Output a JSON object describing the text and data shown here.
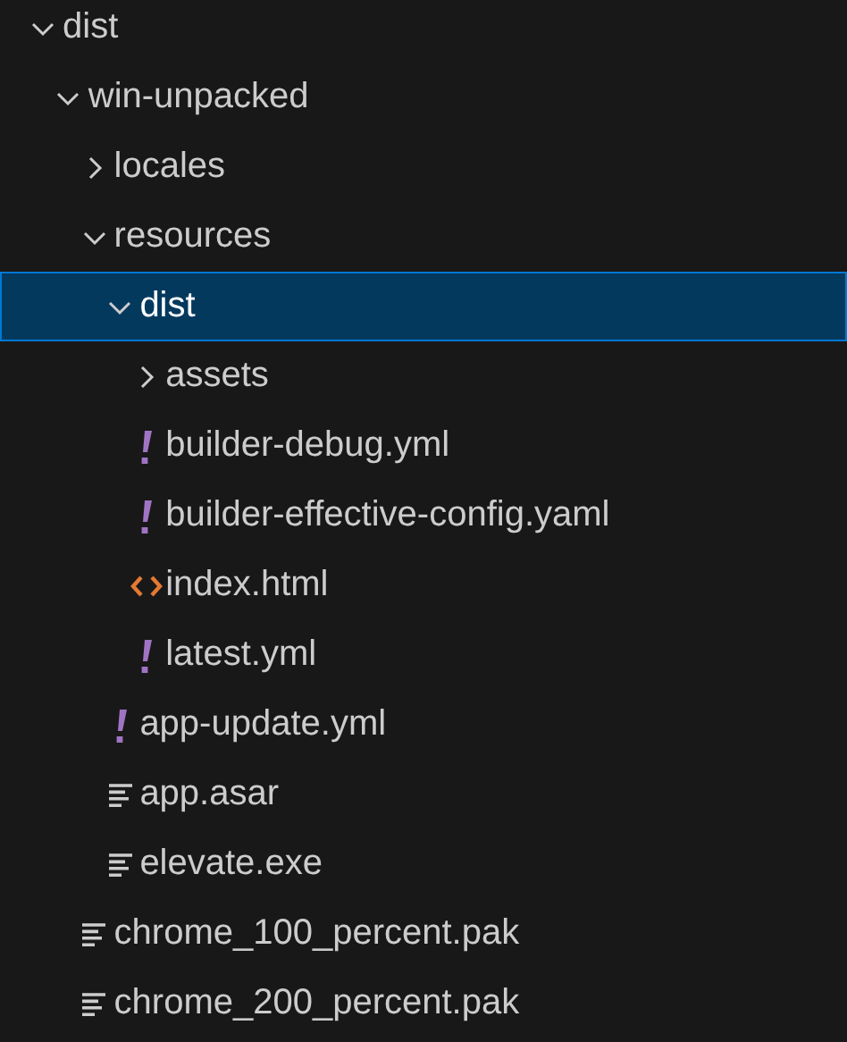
{
  "tree": [
    {
      "name": "dist",
      "kind": "folder",
      "expanded": true,
      "selected": false,
      "children": [
        {
          "name": "win-unpacked",
          "kind": "folder",
          "expanded": true,
          "selected": false,
          "children": [
            {
              "name": "locales",
              "kind": "folder",
              "expanded": false,
              "selected": false
            },
            {
              "name": "resources",
              "kind": "folder",
              "expanded": true,
              "selected": false,
              "children": [
                {
                  "name": "dist",
                  "kind": "folder",
                  "expanded": true,
                  "selected": true,
                  "children": [
                    {
                      "name": "assets",
                      "kind": "folder",
                      "expanded": false,
                      "selected": false
                    },
                    {
                      "name": "builder-debug.yml",
                      "kind": "yaml",
                      "selected": false
                    },
                    {
                      "name": "builder-effective-config.yaml",
                      "kind": "yaml",
                      "selected": false
                    },
                    {
                      "name": "index.html",
                      "kind": "html",
                      "selected": false
                    },
                    {
                      "name": "latest.yml",
                      "kind": "yaml",
                      "selected": false
                    }
                  ]
                },
                {
                  "name": "app-update.yml",
                  "kind": "yaml",
                  "selected": false
                },
                {
                  "name": "app.asar",
                  "kind": "text",
                  "selected": false
                },
                {
                  "name": "elevate.exe",
                  "kind": "text",
                  "selected": false
                }
              ]
            },
            {
              "name": "chrome_100_percent.pak",
              "kind": "text",
              "selected": false
            },
            {
              "name": "chrome_200_percent.pak",
              "kind": "text",
              "selected": false
            }
          ]
        }
      ]
    }
  ]
}
